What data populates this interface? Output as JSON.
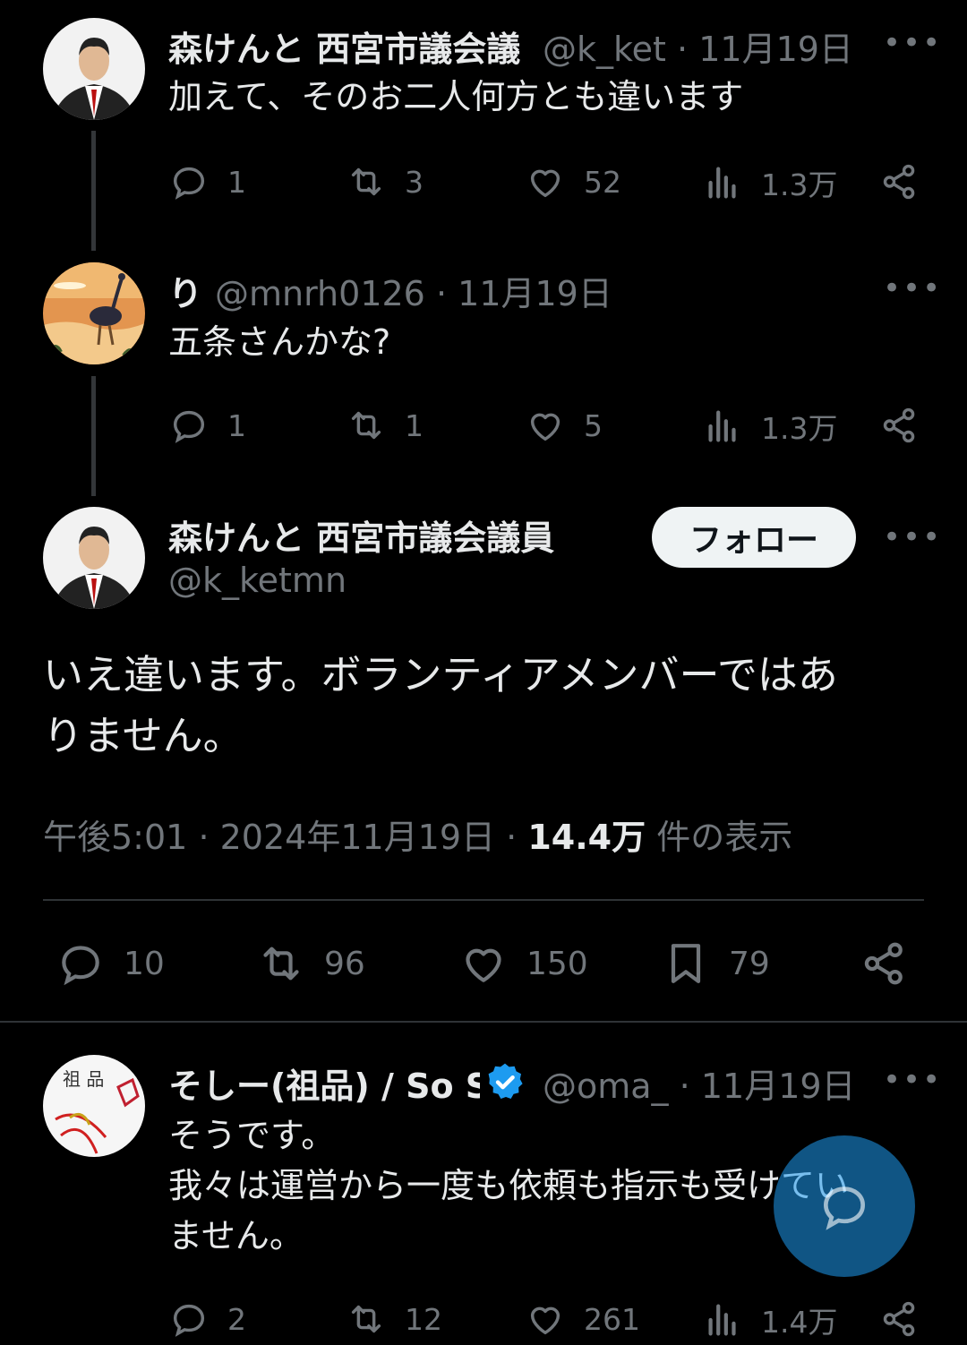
{
  "tweets": [
    {
      "name": "森けんと 西宮市議会議",
      "handle": "@k_ket",
      "dot": "·",
      "date": "11月19日",
      "text": "加えて、そのお二人何方とも違います",
      "replies": "1",
      "retweets": "3",
      "likes": "52",
      "views": "1.3万"
    },
    {
      "name": "り",
      "handle": "@mnrh0126",
      "dot": "·",
      "date": "11月19日",
      "text": "五条さんかな?",
      "replies": "1",
      "retweets": "1",
      "likes": "5",
      "views": "1.3万"
    }
  ],
  "focused": {
    "name": "森けんと 西宮市議会議員",
    "handle": "@k_ketmn",
    "follow_label": "フォロー",
    "text_line1": "いえ違います。ボランティアメンバーではあ",
    "text_line2": "りません。",
    "time": "午後5:01",
    "dot": "·",
    "date": "2024年11月19日",
    "views_count": "14.4万",
    "views_label": "件の表示",
    "replies": "10",
    "retweets": "96",
    "likes": "150",
    "bookmarks": "79"
  },
  "reply": {
    "name": "そしー(祖品) / So S",
    "handle": "@oma_",
    "dot": "·",
    "date": "11月19日",
    "text_line1": "そうです。",
    "text_line2": "我々は運営から一度も依頼も指示も受けてい",
    "text_line3": "ません。",
    "replies": "2",
    "retweets": "12",
    "likes": "261",
    "views": "1.4万"
  },
  "avatar_texts": {
    "so_avatar": "祖 品"
  },
  "colors": {
    "accent": "#1d9bf0",
    "muted": "#71767b",
    "text": "#e7e9ea",
    "background": "#000000"
  },
  "icons": [
    "reply-icon",
    "retweet-icon",
    "like-icon",
    "views-icon",
    "share-icon",
    "bookmark-icon",
    "more-icon",
    "verified-badge-icon",
    "compose-icon"
  ]
}
